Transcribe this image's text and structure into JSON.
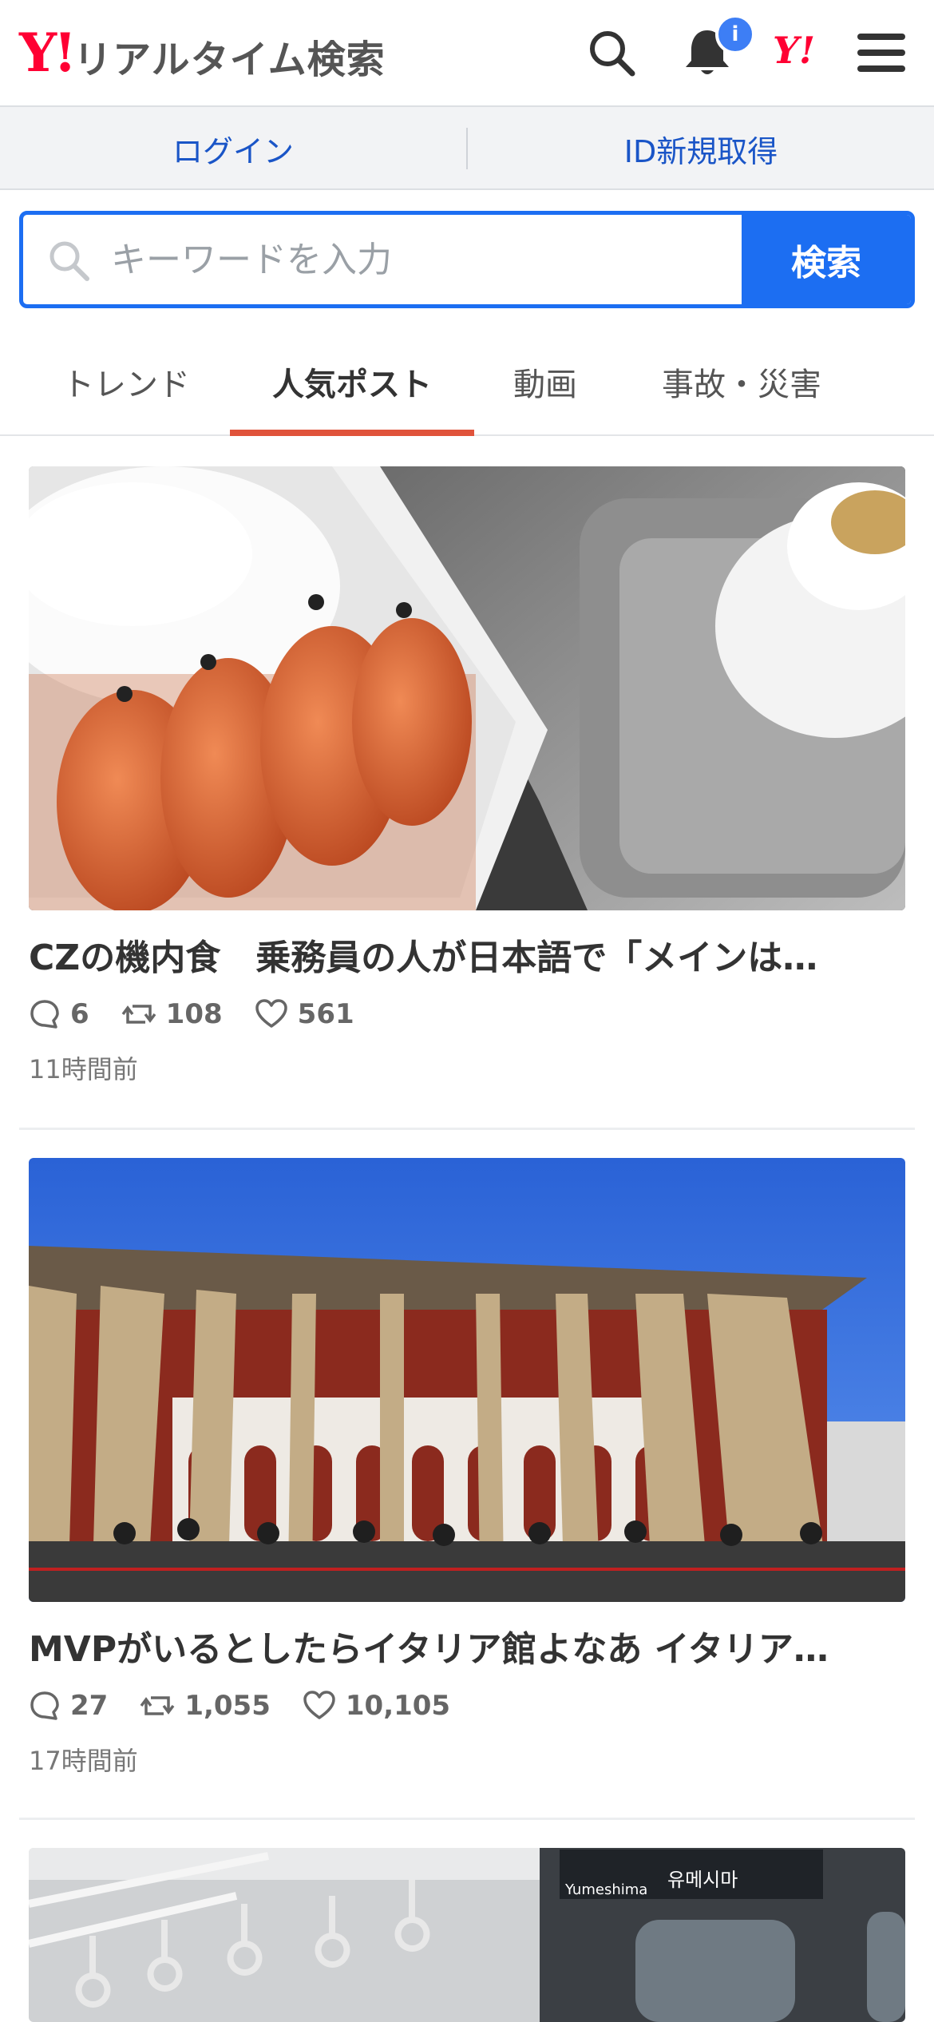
{
  "header": {
    "logo_mark": "Y!",
    "logo_text": "リアルタイム検索",
    "notification_badge": "i",
    "yahoo_small_logo": "Y!",
    "icons": [
      "search-icon",
      "bell-icon",
      "yahoo-logo-icon",
      "menu-icon"
    ]
  },
  "auth": {
    "login": "ログイン",
    "signup": "ID新規取得"
  },
  "search": {
    "placeholder": "キーワードを入力",
    "button": "検索"
  },
  "tabs": [
    {
      "label": "トレンド",
      "active": false
    },
    {
      "label": "人気ポスト",
      "active": true
    },
    {
      "label": "動画",
      "active": false
    },
    {
      "label": "事故・災害",
      "active": false
    }
  ],
  "posts": [
    {
      "title": "CZの機内食　乗務員の人が日本語で「メインは…",
      "replies": "6",
      "reposts": "108",
      "likes": "561",
      "time": "11時間前"
    },
    {
      "title": "MVPがいるとしたらイタリア館よなあ イタリア…",
      "replies": "27",
      "reposts": "1,055",
      "likes": "10,105",
      "time": "17時間前"
    },
    {
      "sign_en": "Yumeshima",
      "sign_kr": "유메시마"
    }
  ],
  "colors": {
    "brand_red": "#ff0033",
    "accent_blue": "#1c6ef2",
    "tab_underline": "#e0533b",
    "link_blue": "#1a55c7"
  }
}
